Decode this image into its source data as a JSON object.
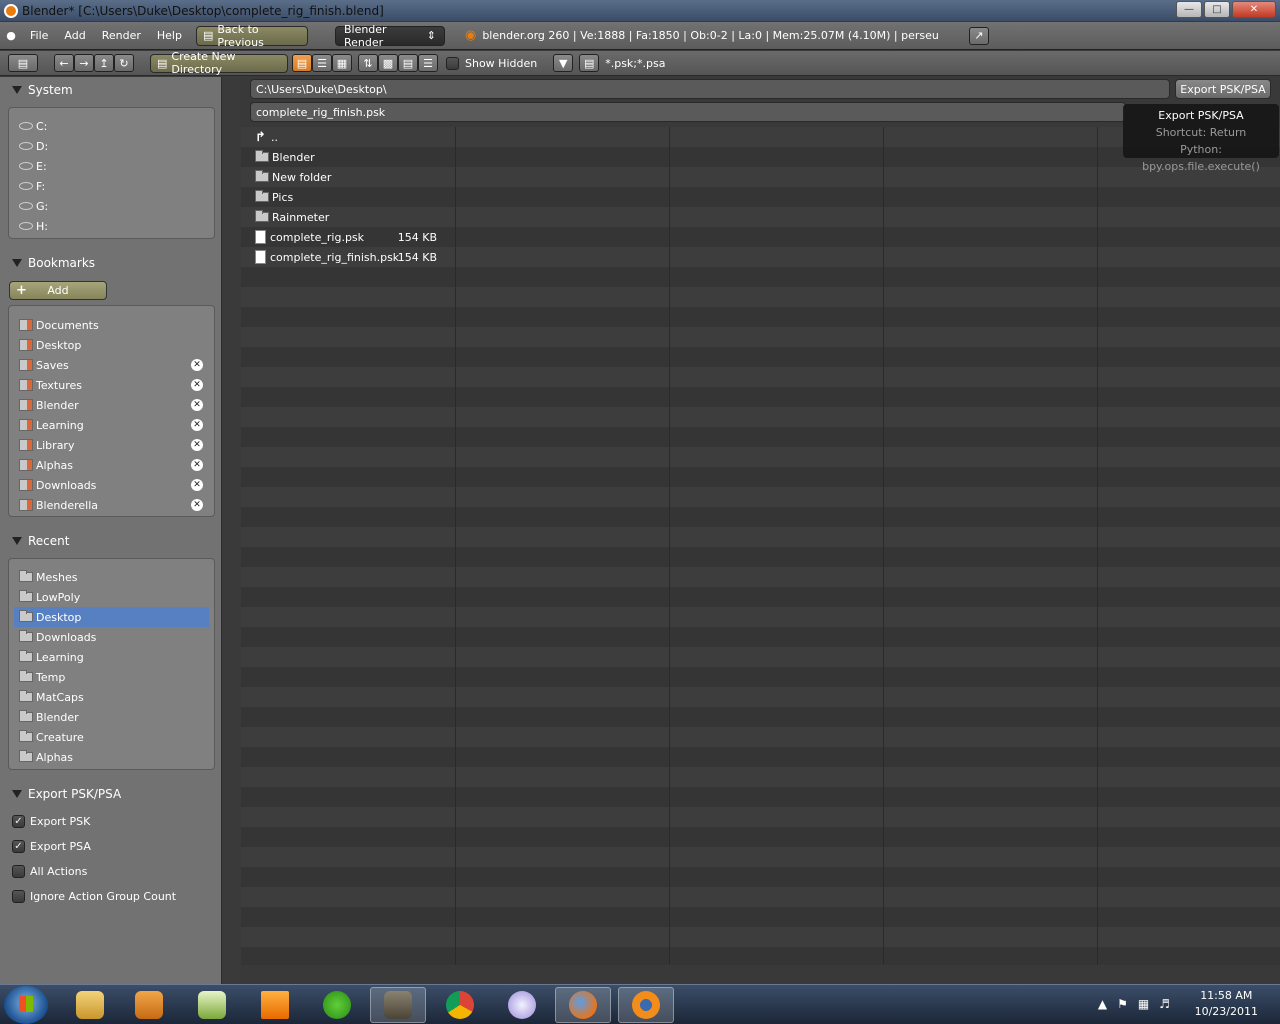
{
  "window": {
    "title": "Blender* [C:\\Users\\Duke\\Desktop\\complete_rig_finish.blend]"
  },
  "menus": [
    "File",
    "Add",
    "Render",
    "Help"
  ],
  "header": {
    "back_label": "Back to Previous",
    "engine": "Blender Render",
    "stats": "blender.org 260 | Ve:1888 | Fa:1850 | Ob:0-2 | La:0 | Mem:25.07M (4.10M) | perseu"
  },
  "filebrowser_header": {
    "create_dir_label": "Create New Directory",
    "show_hidden_label": "Show Hidden",
    "filter": "*.psk;*.psa"
  },
  "panels": {
    "system": {
      "title": "System",
      "items": [
        "C:",
        "D:",
        "E:",
        "F:",
        "G:",
        "H:"
      ]
    },
    "bookmarks": {
      "title": "Bookmarks",
      "add_label": "Add",
      "items": [
        "Documents",
        "Desktop",
        "Saves",
        "Textures",
        "Blender",
        "Learning",
        "Library",
        "Alphas",
        "Downloads",
        "Blenderella"
      ]
    },
    "recent": {
      "title": "Recent",
      "items": [
        "Meshes",
        "LowPoly",
        "Desktop",
        "Downloads",
        "Learning",
        "Temp",
        "MatCaps",
        "Blender",
        "Creature",
        "Alphas"
      ],
      "selected": "Desktop"
    },
    "export": {
      "title": "Export PSK/PSA",
      "options": [
        {
          "label": "Export PSK",
          "checked": true
        },
        {
          "label": "Export PSA",
          "checked": true
        },
        {
          "label": "All Actions",
          "checked": false
        },
        {
          "label": "Ignore Action Group Count",
          "checked": false
        }
      ]
    }
  },
  "path": {
    "directory": "C:\\Users\\Duke\\Desktop\\",
    "filename": "complete_rig_finish.psk",
    "export_button": "Export PSK/PSA"
  },
  "files": [
    {
      "name": "..",
      "type": "parent",
      "size": ""
    },
    {
      "name": "Blender",
      "type": "folder",
      "size": ""
    },
    {
      "name": "New folder",
      "type": "folder",
      "size": ""
    },
    {
      "name": "Pics",
      "type": "folder",
      "size": ""
    },
    {
      "name": "Rainmeter",
      "type": "folder",
      "size": ""
    },
    {
      "name": "complete_rig.psk",
      "type": "file",
      "size": "154 KB"
    },
    {
      "name": "complete_rig_finish.psk",
      "type": "file",
      "size": "154 KB"
    }
  ],
  "tooltip": {
    "title": "Export PSK/PSA",
    "shortcut": "Shortcut: Return",
    "python": "Python: bpy.ops.file.execute()"
  },
  "taskbar": {
    "time": "11:58 AM",
    "date": "10/23/2011",
    "apps": [
      "explorer-icon",
      "media-center-icon",
      "notepad-icon",
      "vlc-icon",
      "utorrent-icon",
      "gimp-icon",
      "chrome-icon",
      "pidgin-icon",
      "firefox-icon",
      "blender-icon"
    ]
  }
}
